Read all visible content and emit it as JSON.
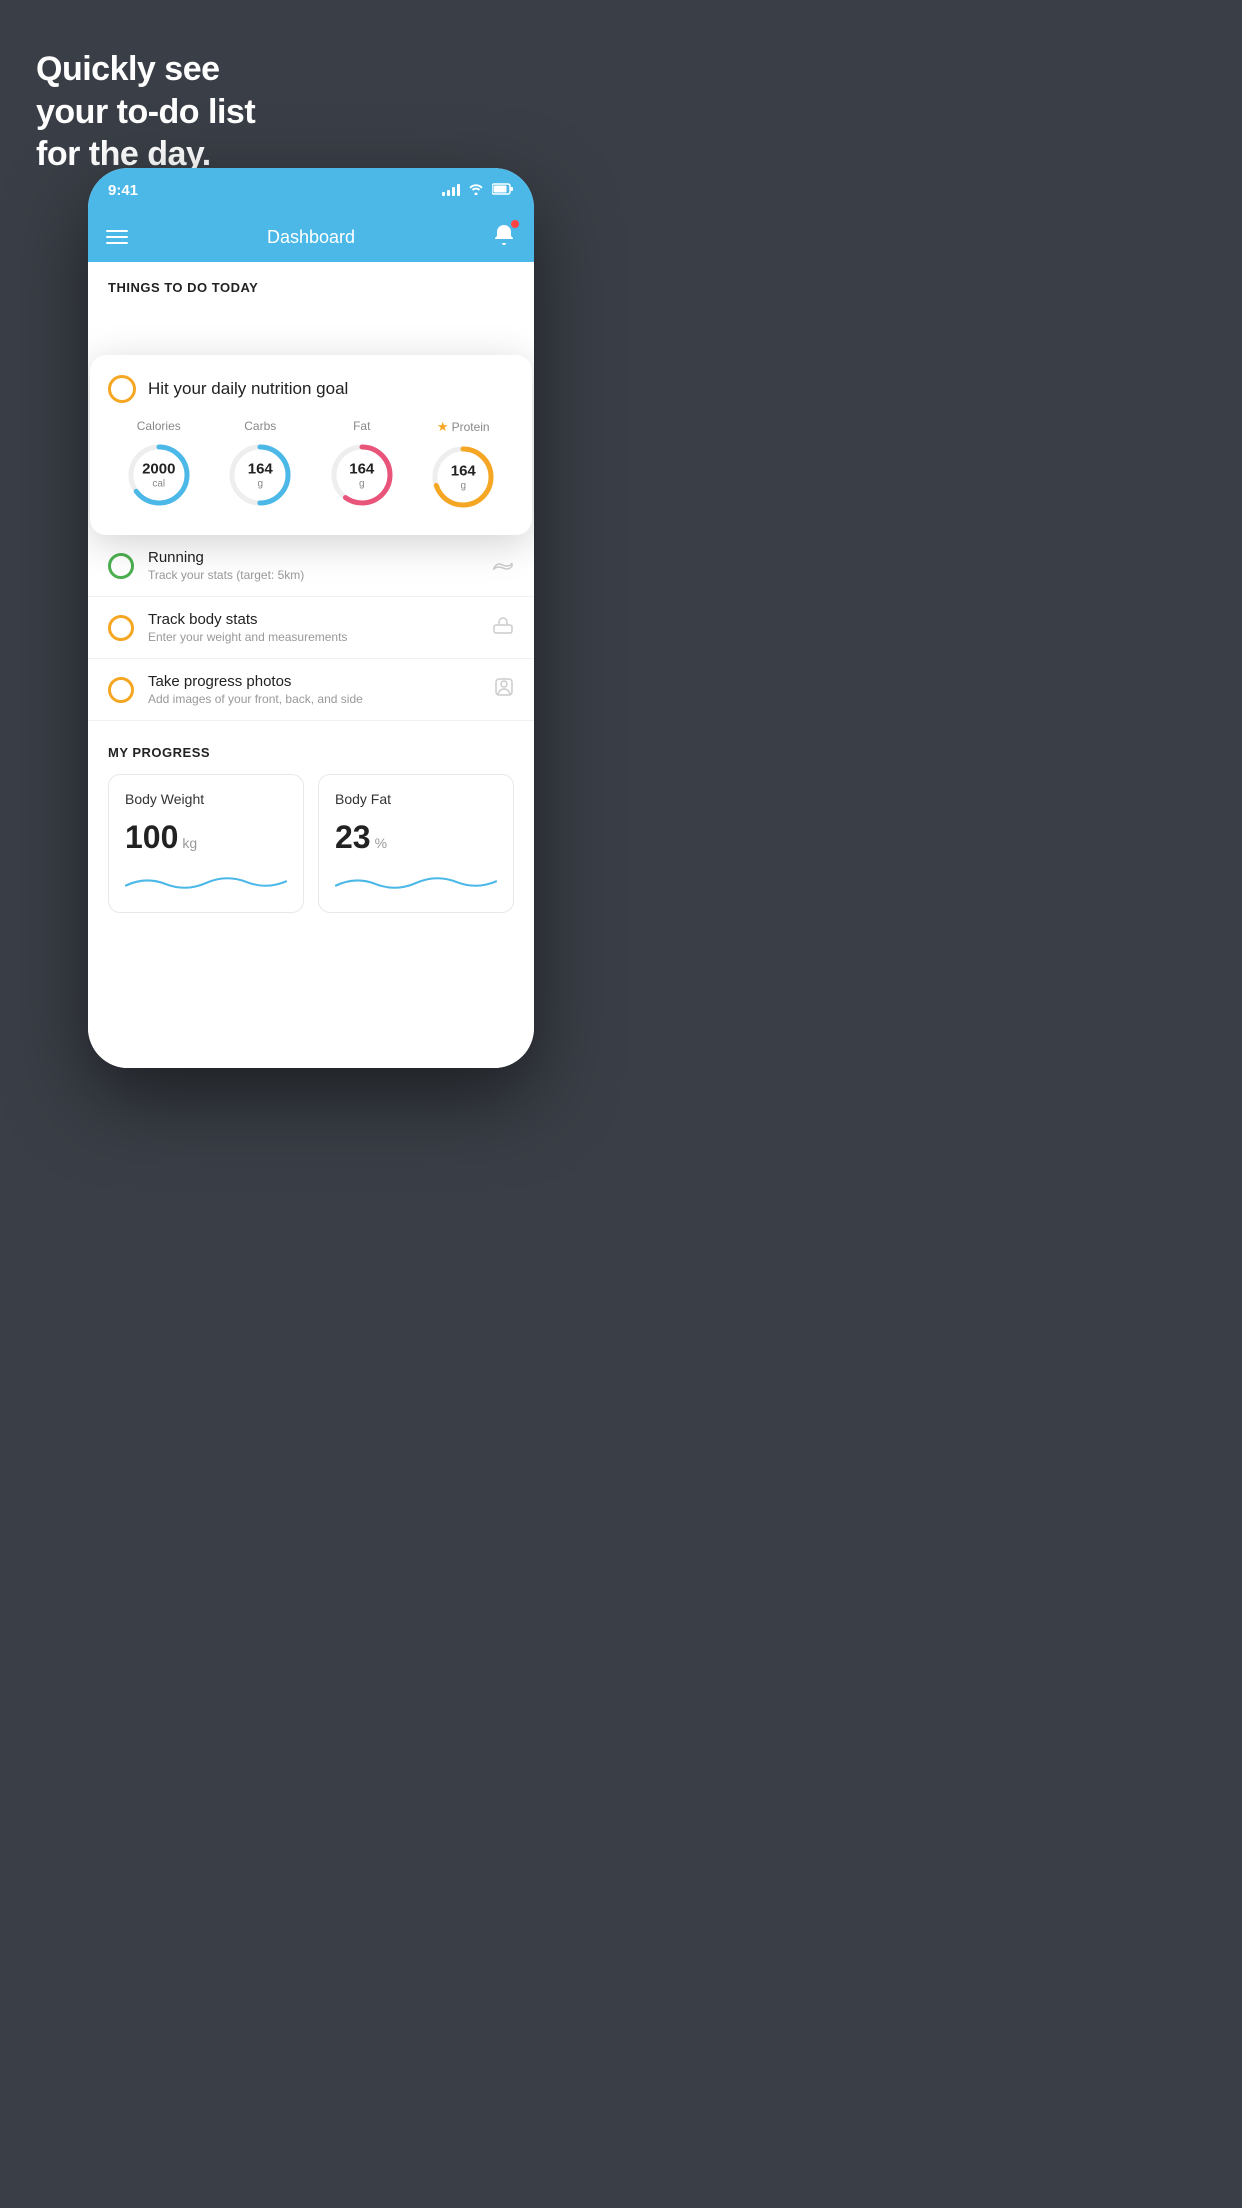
{
  "hero": {
    "line1": "Quickly see",
    "line2": "your to-do list",
    "line3": "for the day."
  },
  "phone": {
    "statusBar": {
      "time": "9:41"
    },
    "navBar": {
      "title": "Dashboard"
    },
    "thingsToDo": {
      "sectionTitle": "THINGS TO DO TODAY",
      "nutritionCard": {
        "title": "Hit your daily nutrition goal",
        "macros": [
          {
            "label": "Calories",
            "value": "2000",
            "unit": "cal",
            "color": "#4bb8e8",
            "pct": 65
          },
          {
            "label": "Carbs",
            "value": "164",
            "unit": "g",
            "color": "#4bb8e8",
            "pct": 50
          },
          {
            "label": "Fat",
            "value": "164",
            "unit": "g",
            "color": "#e8547a",
            "pct": 60
          },
          {
            "label": "Protein",
            "value": "164",
            "unit": "g",
            "color": "#f5a623",
            "pct": 70,
            "star": true
          }
        ]
      },
      "items": [
        {
          "title": "Running",
          "subtitle": "Track your stats (target: 5km)",
          "circleColor": "green",
          "icon": "shoe"
        },
        {
          "title": "Track body stats",
          "subtitle": "Enter your weight and measurements",
          "circleColor": "yellow",
          "icon": "scale"
        },
        {
          "title": "Take progress photos",
          "subtitle": "Add images of your front, back, and side",
          "circleColor": "yellow",
          "icon": "person"
        }
      ]
    },
    "myProgress": {
      "sectionTitle": "MY PROGRESS",
      "cards": [
        {
          "title": "Body Weight",
          "value": "100",
          "unit": "kg"
        },
        {
          "title": "Body Fat",
          "value": "23",
          "unit": "%"
        }
      ]
    }
  }
}
